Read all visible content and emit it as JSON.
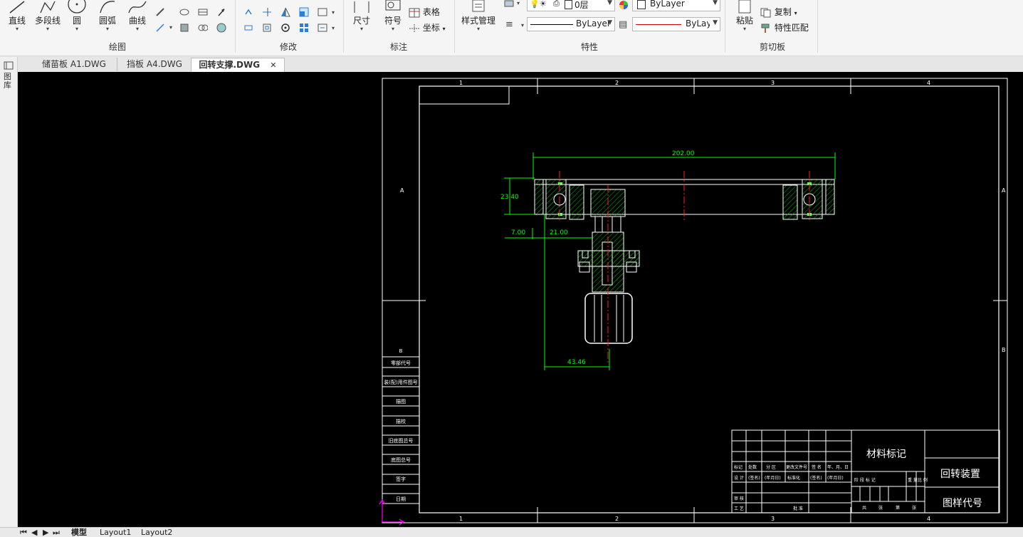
{
  "ribbon": {
    "draw": {
      "label": "绘图",
      "line": "直线",
      "polyline": "多段线",
      "circle": "圆",
      "arc": "圆弧",
      "curve": "曲线"
    },
    "modify": {
      "label": "修改"
    },
    "annotate": {
      "label": "标注",
      "dimension": "尺寸",
      "symbol": "符号",
      "table": "表格",
      "coordinate": "坐标"
    },
    "properties": {
      "label": "特性",
      "style_manager": "样式管理",
      "layer": "0层",
      "color": "ByLayer",
      "linetype": "ByLayer",
      "lineweight": "ByLayer"
    },
    "clipboard": {
      "label": "剪切板",
      "paste": "粘贴",
      "copy": "复制",
      "match_props": "特性匹配"
    }
  },
  "file_tabs": [
    {
      "label": "储苗板 A1.DWG"
    },
    {
      "label": "挡板 A4.DWG"
    },
    {
      "label": "回转支撑.DWG",
      "close": "✕"
    }
  ],
  "left_panel": {
    "label": "图库"
  },
  "drawing": {
    "dims": {
      "d1": "202.00",
      "d2": "23.40",
      "d3": "7.00",
      "d4": "21.00",
      "d5": "43.46"
    },
    "frame_numbers": [
      "1",
      "2",
      "3",
      "4"
    ],
    "frame_letters": [
      "A",
      "B"
    ],
    "left_strip": [
      "B",
      "零部代号",
      "装(配)用件图号",
      "描图",
      "描校",
      "旧底图总号",
      "底图总号",
      "签字",
      "日期"
    ],
    "title_block": {
      "material": "材料标记",
      "name": "回转装置",
      "drawing_no": "图样代号",
      "row_a": [
        "标记",
        "处数",
        "分  区",
        "更改文件号",
        "签  名",
        "年、月、日"
      ],
      "row_b": [
        "设  计",
        "(签名)",
        "(年月日)",
        "标准化",
        "(签名)",
        "(年月日)"
      ],
      "row_c": [
        "审  核"
      ],
      "row_d": [
        "工  艺",
        "批  准"
      ],
      "stage_labels": [
        "阶  段  标  记",
        "重  量",
        "比  例"
      ],
      "sheet_labels": [
        "共",
        "张",
        "第",
        "张"
      ]
    }
  },
  "model_tabs": [
    {
      "label": "模型"
    },
    {
      "label": "Layout1"
    },
    {
      "label": "Layout2"
    }
  ],
  "colors": {
    "canvas_bg": "#000000",
    "line_white": "#ffffff",
    "dim_green": "#00ff00",
    "center_red": "#ff0000",
    "hatch_green": "#00cc00",
    "ucs_magenta": "#ff00ff"
  }
}
